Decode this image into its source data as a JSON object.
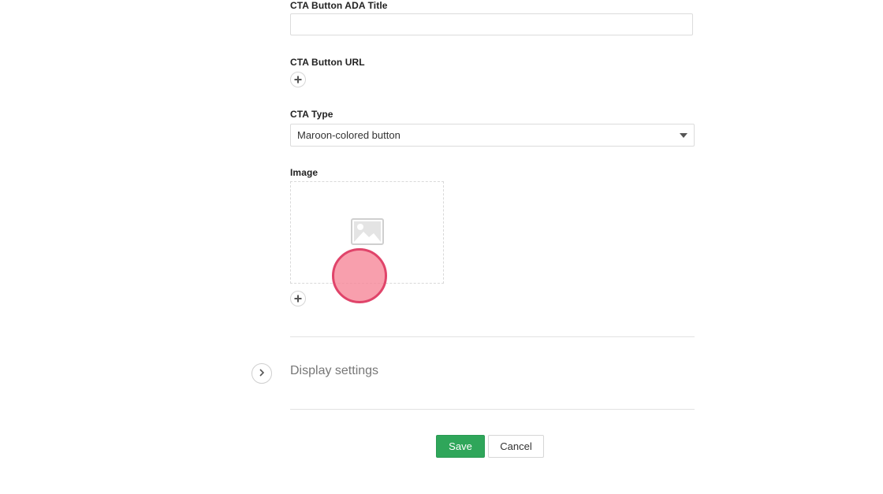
{
  "form": {
    "cta_ada_title": {
      "label": "CTA Button ADA Title",
      "value": ""
    },
    "cta_url": {
      "label": "CTA Button URL",
      "add_icon": "plus-icon"
    },
    "cta_type": {
      "label": "CTA Type",
      "selected": "Maroon-colored button",
      "caret_icon": "caret-down-icon"
    },
    "image": {
      "label": "Image",
      "placeholder_icon": "image-placeholder-icon",
      "add_icon": "plus-icon"
    }
  },
  "display_settings": {
    "title": "Display settings",
    "toggle_icon": "chevron-right-icon"
  },
  "actions": {
    "save_label": "Save",
    "cancel_label": "Cancel"
  },
  "colors": {
    "save_button": "#2fa65a",
    "cursor_highlight": "#f68496",
    "cursor_border": "#e0446a"
  }
}
